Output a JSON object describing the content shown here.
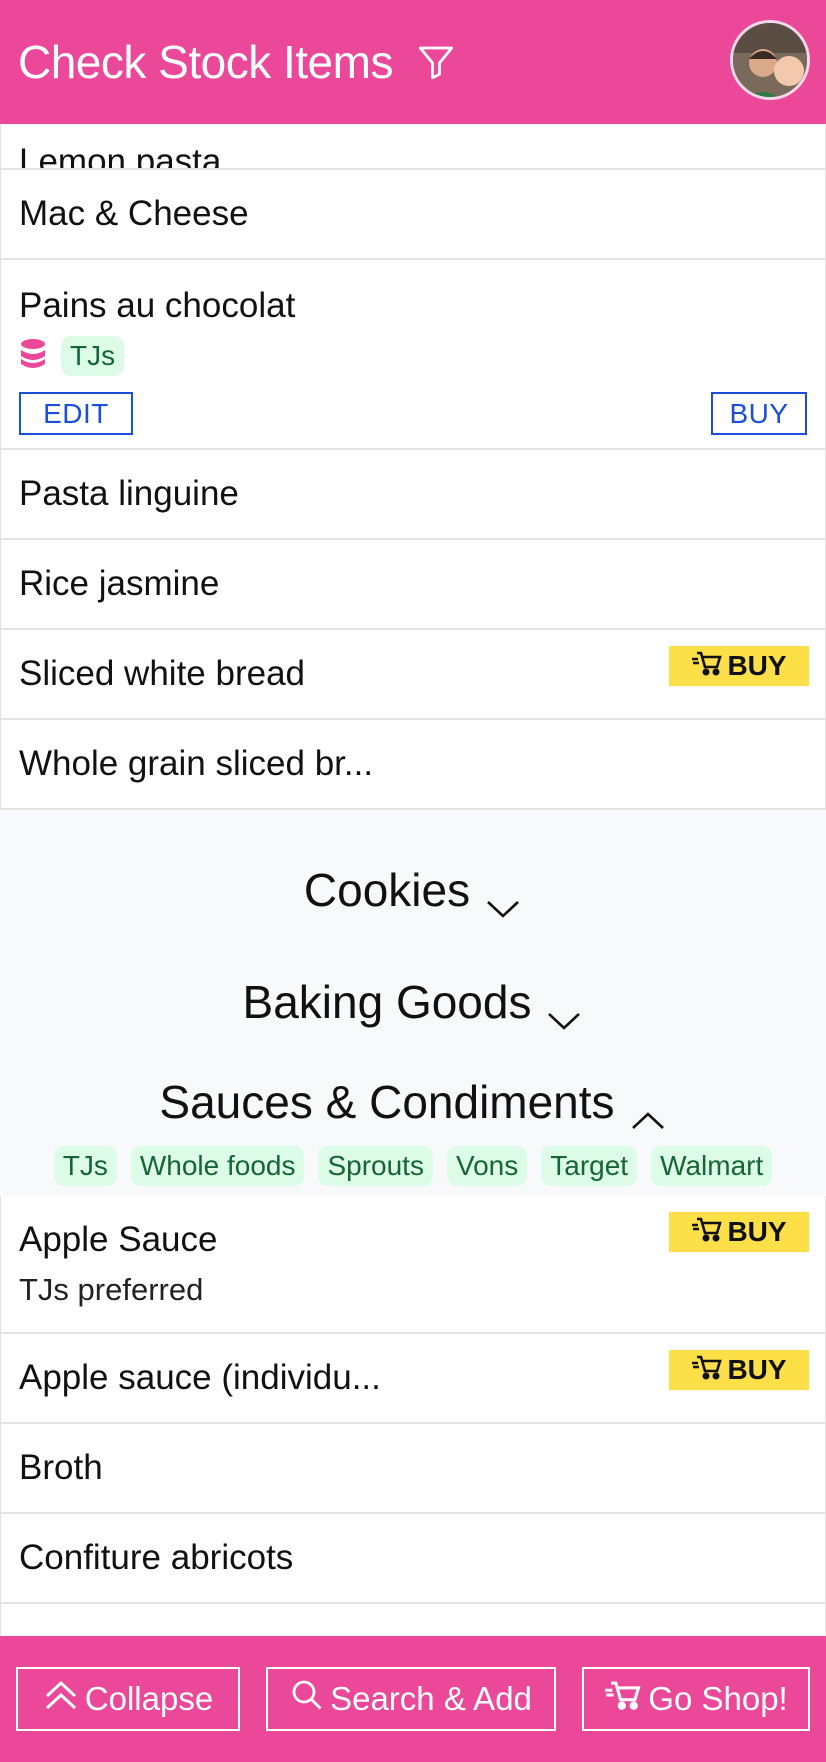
{
  "header": {
    "title": "Check Stock Items"
  },
  "items_top": [
    {
      "name": "Lemon pasta"
    },
    {
      "name": "Mac & Cheese"
    }
  ],
  "expanded_item": {
    "name": "Pains au chocolat",
    "store_tag": "TJs",
    "edit_label": "EDIT",
    "buy_label": "BUY"
  },
  "items_mid": [
    {
      "name": "Pasta linguine"
    },
    {
      "name": "Rice jasmine"
    },
    {
      "name": "Sliced white bread",
      "buy": "BUY"
    },
    {
      "name": "Whole grain sliced br..."
    }
  ],
  "categories": [
    {
      "title": "Cookies",
      "state": "collapsed"
    },
    {
      "title": "Baking Goods",
      "state": "collapsed"
    },
    {
      "title": "Sauces & Condiments",
      "state": "expanded"
    }
  ],
  "store_filters": [
    "TJs",
    "Whole foods",
    "Sprouts",
    "Vons",
    "Target",
    "Walmart"
  ],
  "sauces_items": [
    {
      "name": "Apple Sauce",
      "note": "TJs preferred",
      "buy": "BUY"
    },
    {
      "name": "Apple sauce (individu...",
      "buy": "BUY"
    },
    {
      "name": "Broth"
    },
    {
      "name": "Confiture abricots"
    }
  ],
  "footer": {
    "collapse_label": "Collapse",
    "search_label": "Search & Add",
    "shop_label": "Go Shop!"
  },
  "colors": {
    "primary": "#ec4899",
    "buy_badge": "#fde047",
    "tag_bg": "#dcfce7",
    "tag_text": "#166534",
    "button_blue": "#1d4ed8"
  }
}
